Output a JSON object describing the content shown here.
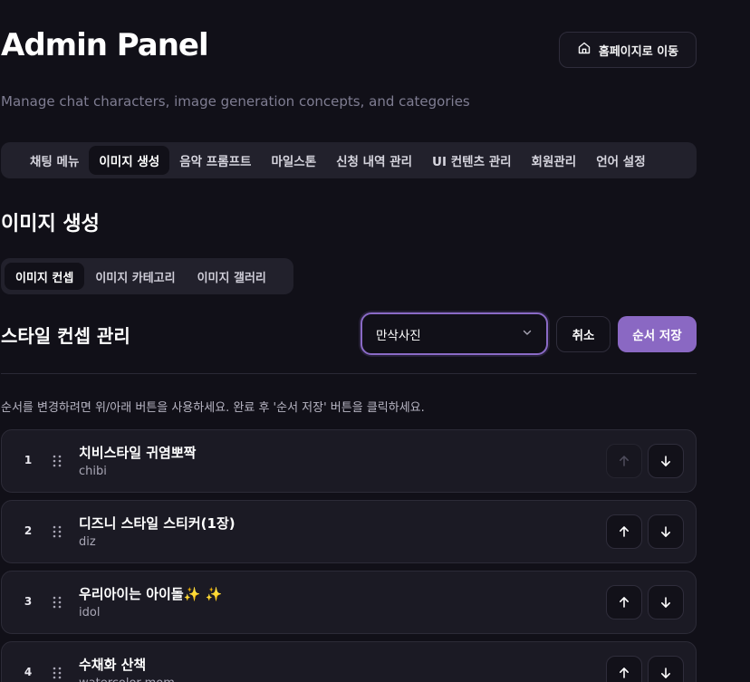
{
  "header": {
    "title": "Admin Panel",
    "subtitle": "Manage chat characters, image generation concepts, and categories",
    "home_button": "홈페이지로 이동"
  },
  "main_tabs": [
    {
      "label": "채팅 메뉴",
      "active": false
    },
    {
      "label": "이미지 생성",
      "active": true
    },
    {
      "label": "음악 프롬프트",
      "active": false
    },
    {
      "label": "마일스톤",
      "active": false
    },
    {
      "label": "신청 내역 관리",
      "active": false
    },
    {
      "label": "UI 컨텐츠 관리",
      "active": false
    },
    {
      "label": "회원관리",
      "active": false
    },
    {
      "label": "언어 설정",
      "active": false
    }
  ],
  "section": {
    "title": "이미지 생성"
  },
  "sub_tabs": [
    {
      "label": "이미지 컨셉",
      "active": true
    },
    {
      "label": "이미지 카테고리",
      "active": false
    },
    {
      "label": "이미지 갤러리",
      "active": false
    }
  ],
  "concepts": {
    "title": "스타일 컨셉 관리",
    "category_select": "만삭사진",
    "cancel_label": "취소",
    "save_order_label": "순서 저장",
    "hint": "순서를 변경하려면 위/아래 버튼을 사용하세요. 완료 후 '순서 저장' 버튼을 클릭하세요.",
    "items": [
      {
        "order": "1",
        "name": "치비스타일 귀염뽀짝",
        "key": "chibi",
        "up_disabled": true
      },
      {
        "order": "2",
        "name": "디즈니 스타일 스티커(1장)",
        "key": "diz",
        "up_disabled": false
      },
      {
        "order": "3",
        "name": "우리아이는 아이돌✨ ✨",
        "key": "idol",
        "up_disabled": false
      },
      {
        "order": "4",
        "name": "수채화 산책",
        "key": "watercolor-mom",
        "up_disabled": false
      }
    ]
  },
  "colors": {
    "background": "#111018",
    "accent": "#8a68c3",
    "surface": "#1b1a24"
  },
  "icons": {
    "home": "home-icon",
    "chevron": "chevron-down-icon",
    "grip": "grip-icon",
    "up": "arrow-up-icon",
    "down": "arrow-down-icon"
  }
}
